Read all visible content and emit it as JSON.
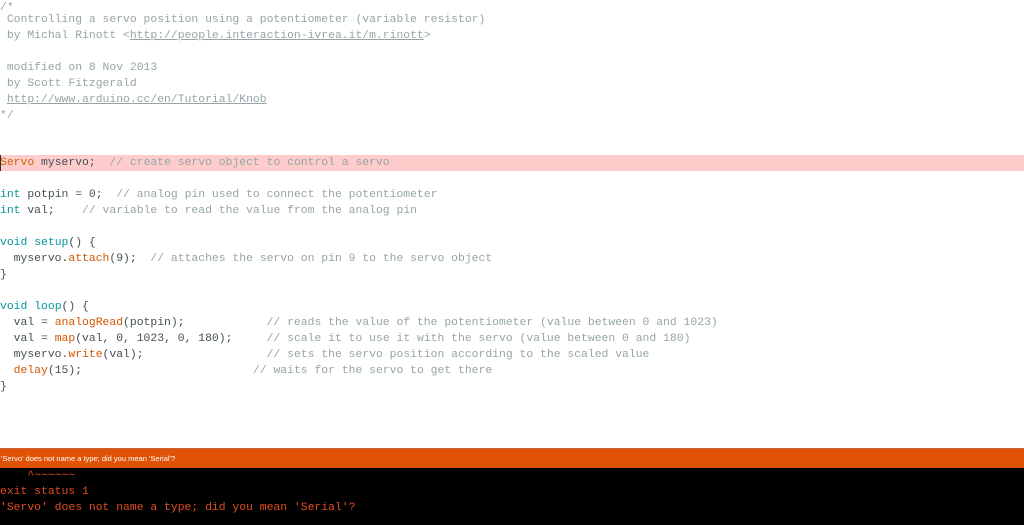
{
  "editor": {
    "header_comment": [
      "/*",
      " Controlling a servo position using a potentiometer (variable resistor)",
      " by Michal Rinott <",
      " modified on 8 Nov 2013",
      " by Scott Fitzgerald",
      "*/"
    ],
    "author_url": "http://people.interaction-ivrea.it/m.rinott",
    "tutorial_url": "http://www.arduino.cc/en/Tutorial/Knob",
    "code": {
      "servo_type": "Servo",
      "servo_decl": " myservo;",
      "servo_comment": "  // create servo object to control a servo",
      "int_kw": "int",
      "potpin_decl": " potpin = 0;",
      "potpin_comment": "  // analog pin used to connect the potentiometer",
      "val_decl": " val;",
      "val_comment": "    // variable to read the value from the analog pin",
      "void_kw": "void",
      "setup_fn": "setup",
      "setup_tail": "() {",
      "attach_pre": "  myservo.",
      "attach_fn": "attach",
      "attach_args": "(9);",
      "attach_comment": "  // attaches the servo on pin 9 to the servo object",
      "close_brace": "}",
      "loop_fn": "loop",
      "loop_tail": "() {",
      "read_pre": "  val = ",
      "read_fn": "analogRead",
      "read_args": "(potpin);            ",
      "read_comment": "// reads the value of the potentiometer (value between 0 and 1023)",
      "map_pre": "  val = ",
      "map_fn": "map",
      "map_args": "(val, 0, 1023, 0, 180);     ",
      "map_comment": "// scale it to use it with the servo (value between 0 and 180)",
      "write_pre": "  myservo.",
      "write_fn": "write",
      "write_args": "(val);                  ",
      "write_comment": "// sets the servo position according to the scaled value",
      "delay_pre": "  ",
      "delay_fn": "delay",
      "delay_args": "(15);                         ",
      "delay_comment": "// waits for the servo to get there"
    }
  },
  "status_bar": {
    "message": "'Servo' does not name a type; did you mean 'Serial'?"
  },
  "console": {
    "lines": [
      "    ^~~~~~~",
      "exit status 1",
      "'Servo' does not name a type; did you mean 'Serial'?"
    ]
  },
  "colors": {
    "error_line": "#ffcccc",
    "status_bar": "#e05206",
    "console_bg": "#000000",
    "console_text": "#e34c22"
  }
}
